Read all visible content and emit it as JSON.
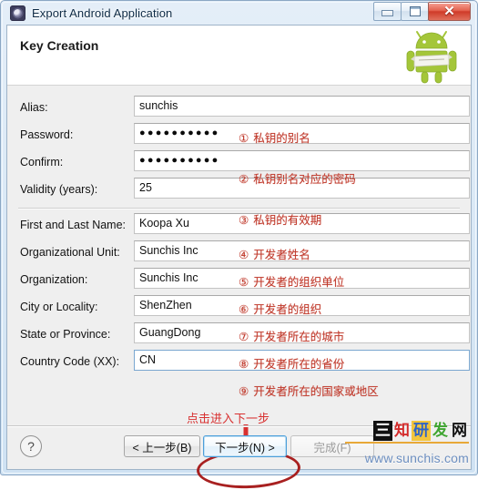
{
  "window": {
    "title": "Export Android Application",
    "app_icon": "android-export-icon",
    "caption_buttons": [
      {
        "name": "minimize",
        "glyph": "minimize-icon"
      },
      {
        "name": "maximize",
        "glyph": "maximize-icon"
      },
      {
        "name": "close",
        "glyph": "✕"
      }
    ]
  },
  "header": {
    "title": "Key Creation",
    "logo": "android-robot-logo"
  },
  "form": {
    "groups": [
      {
        "fields": [
          {
            "label": "Alias:",
            "value": "sunchis",
            "type": "text",
            "focused": false
          },
          {
            "label": "Password:",
            "value": "●●●●●●●●●●",
            "type": "password",
            "focused": false
          },
          {
            "label": "Confirm:",
            "value": "●●●●●●●●●●",
            "type": "password",
            "focused": false
          },
          {
            "label": "Validity (years):",
            "value": "25",
            "type": "text",
            "focused": false
          }
        ]
      },
      {
        "fields": [
          {
            "label": "First and Last Name:",
            "value": "Koopa Xu",
            "type": "text",
            "focused": false
          },
          {
            "label": "Organizational Unit:",
            "value": "Sunchis Inc",
            "type": "text",
            "focused": false
          },
          {
            "label": "Organization:",
            "value": "Sunchis Inc",
            "type": "text",
            "focused": false
          },
          {
            "label": "City or Locality:",
            "value": "ShenZhen",
            "type": "text",
            "focused": false
          },
          {
            "label": "State or Province:",
            "value": "GuangDong",
            "type": "text",
            "focused": false
          },
          {
            "label": "Country Code (XX):",
            "value": "CN",
            "type": "text",
            "focused": true
          }
        ]
      }
    ]
  },
  "annotations": {
    "color": "#c0392b",
    "items": [
      {
        "num": "①",
        "text": "私钥的别名"
      },
      {
        "num": "②",
        "text": "私钥别名对应的密码"
      },
      {
        "num": "③",
        "text": "私钥的有效期"
      },
      {
        "num": "④",
        "text": "开发者姓名"
      },
      {
        "num": "⑤",
        "text": "开发者的组织单位"
      },
      {
        "num": "⑥",
        "text": "开发者的组织"
      },
      {
        "num": "⑦",
        "text": "开发者所在的城市"
      },
      {
        "num": "⑧",
        "text": "开发者所在的省份"
      },
      {
        "num": "⑨",
        "text": "开发者所在的国家或地区"
      }
    ],
    "callout": {
      "text": "点击进入下一步",
      "color": "#d83030"
    }
  },
  "buttons": {
    "help": "?",
    "back": "< 上一步(B)",
    "next": "下一步(N) >",
    "finish": "完成(F)"
  },
  "watermark": {
    "chars": [
      "三",
      "知",
      "研",
      "发",
      "网"
    ],
    "url": "www.sunchis.com"
  }
}
